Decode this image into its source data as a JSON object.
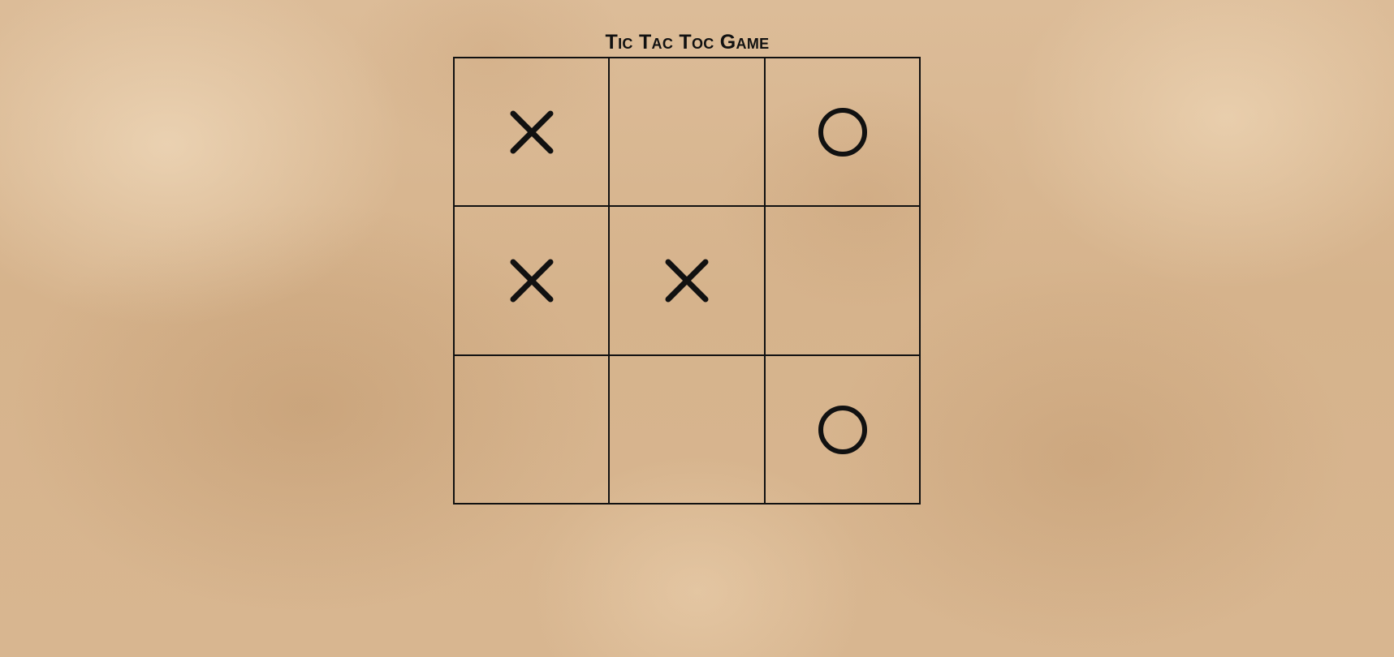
{
  "game": {
    "title": "Tic Tac Toc Game"
  },
  "board": {
    "cells": [
      "X",
      "",
      "O",
      "X",
      "X",
      "",
      "",
      "",
      "O"
    ]
  },
  "colors": {
    "mark": "#111111",
    "grid": "#111111",
    "background": "#d9b894"
  }
}
